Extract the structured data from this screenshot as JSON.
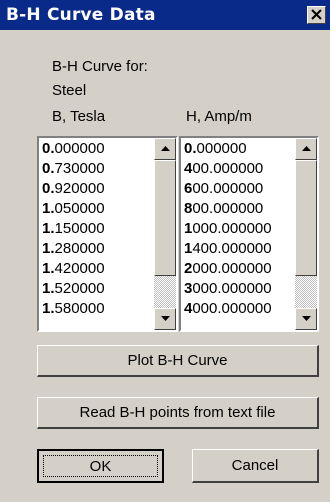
{
  "window": {
    "title": "B-H Curve Data"
  },
  "labels": {
    "curve_for": "B-H Curve for:",
    "material": "Steel",
    "b_header": "B, Tesla",
    "h_header": "H, Amp/m"
  },
  "b_list": [
    "0.000000",
    "0.730000",
    "0.920000",
    "1.050000",
    "1.150000",
    "1.280000",
    "1.420000",
    "1.520000",
    "1.580000"
  ],
  "h_list": [
    "0.000000",
    "400.000000",
    "600.000000",
    "800.000000",
    "1000.000000",
    "1400.000000",
    "2000.000000",
    "3000.000000",
    "4000.000000"
  ],
  "buttons": {
    "plot": "Plot B-H Curve",
    "read": "Read B-H points from text file",
    "ok": "OK",
    "cancel": "Cancel"
  },
  "icons": [
    "close-icon",
    "scroll-up-arrow-icon",
    "scroll-down-arrow-icon"
  ],
  "colors": {
    "titlebar": "#0a2a8a",
    "face": "#d4d0c8"
  }
}
